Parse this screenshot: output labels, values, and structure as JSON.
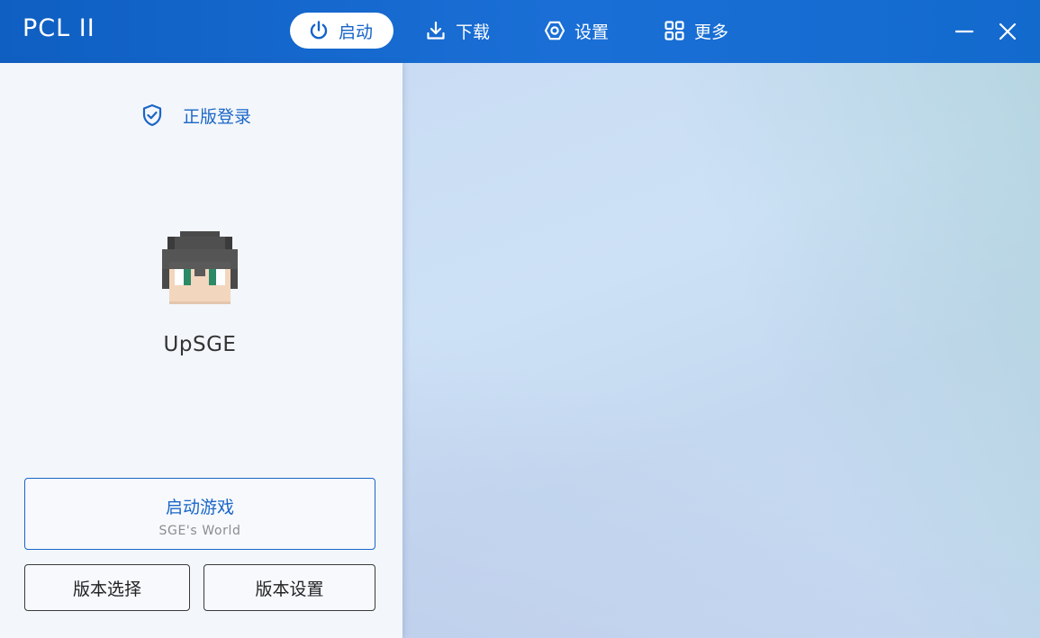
{
  "app": {
    "title": "PCL II"
  },
  "nav": {
    "tabs": [
      {
        "label": "启动",
        "icon": "power-icon",
        "active": true
      },
      {
        "label": "下载",
        "icon": "download-icon",
        "active": false
      },
      {
        "label": "设置",
        "icon": "settings-icon",
        "active": false
      },
      {
        "label": "更多",
        "icon": "grid-icon",
        "active": false
      }
    ]
  },
  "window_controls": {
    "minimize_icon": "minimize-icon",
    "close_icon": "close-icon"
  },
  "sidebar": {
    "login_label": "正版登录",
    "login_icon": "shield-check-icon",
    "username": "UpSGE",
    "launch_button": {
      "label": "启动游戏",
      "sublabel": "SGE's World"
    },
    "version_select_label": "版本选择",
    "version_settings_label": "版本设置"
  },
  "colors": {
    "accent": "#1a66c6",
    "titlebar": "#1468cd"
  }
}
